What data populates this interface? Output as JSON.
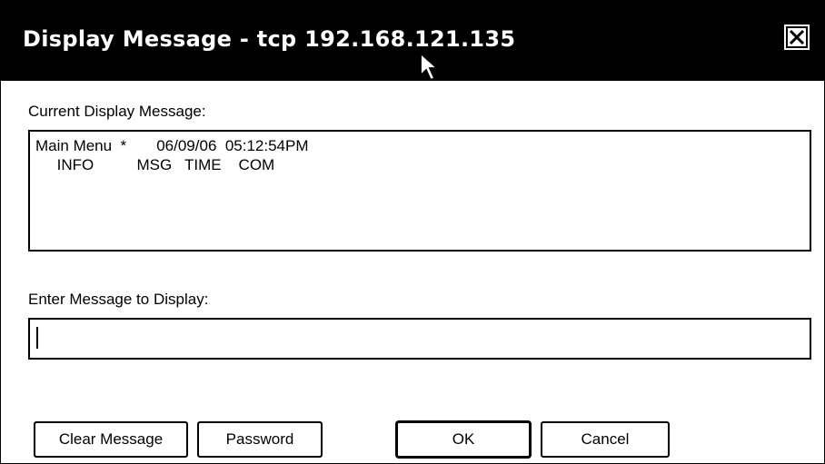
{
  "window": {
    "title": "Display Message - tcp 192.168.121.135"
  },
  "current_display": {
    "label": "Current Display Message:",
    "line1": "Main Menu  *       06/09/06  05:12:54PM",
    "line2": "     INFO          MSG   TIME    COM"
  },
  "enter_message": {
    "label": "Enter Message to Display:",
    "value": ""
  },
  "buttons": {
    "clear": "Clear Message",
    "password": "Password",
    "ok": "OK",
    "cancel": "Cancel"
  },
  "icons": {
    "close": "close-icon",
    "cursor": "mouse-pointer-icon"
  }
}
